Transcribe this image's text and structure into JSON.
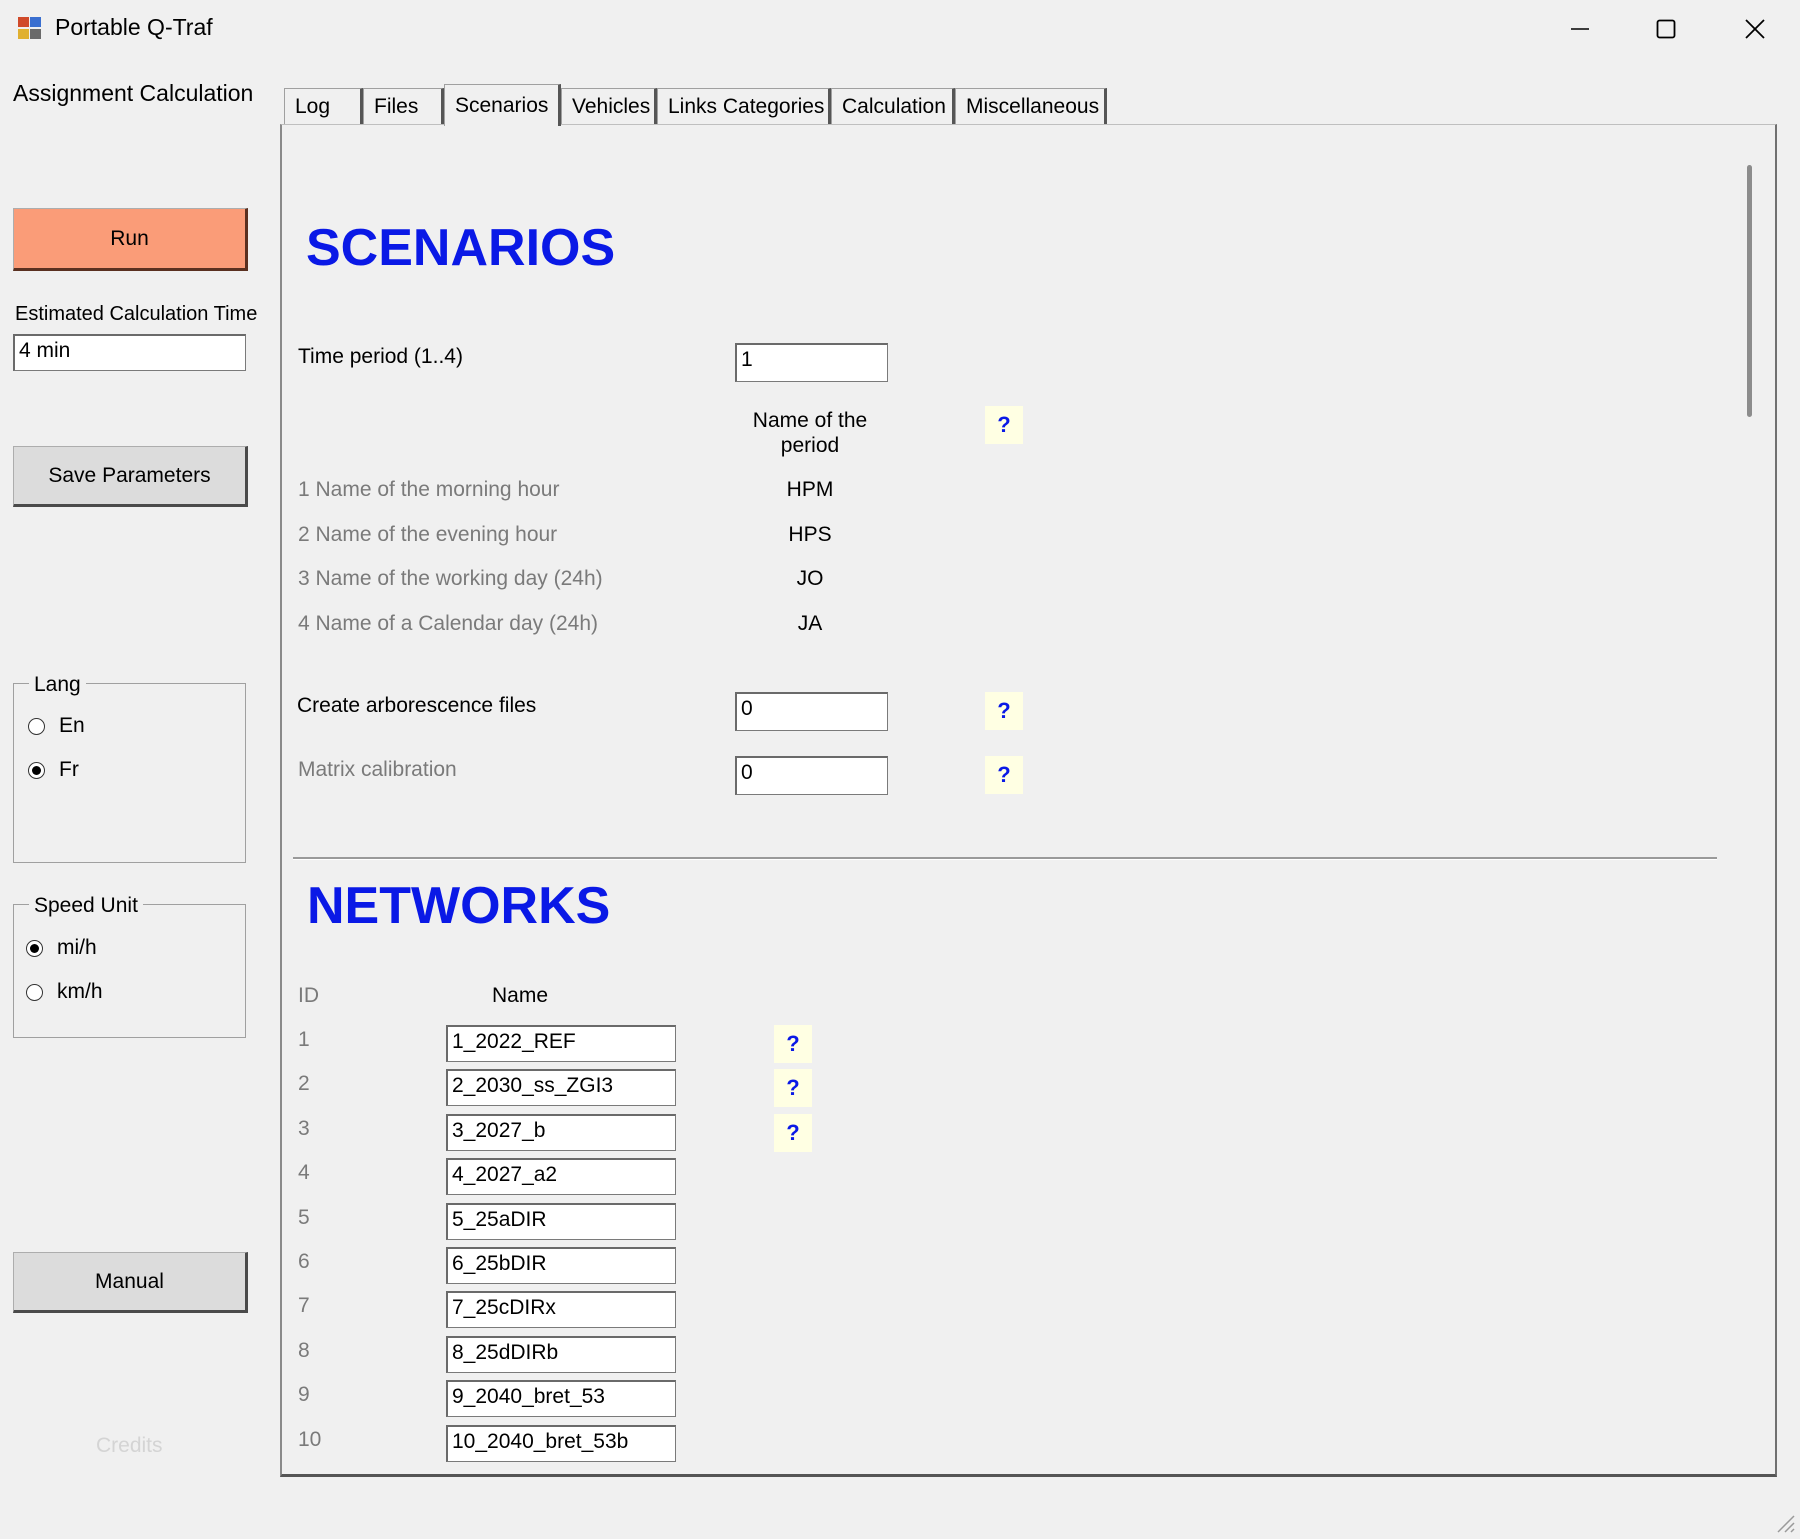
{
  "window": {
    "title": "Portable Q-Traf",
    "controls": [
      "minimize",
      "maximize",
      "close"
    ]
  },
  "sidebar": {
    "heading": "Assignment Calculation",
    "run_label": "Run",
    "estimated_time_label": "Estimated Calculation Time",
    "estimated_time_value": "4 min",
    "save_label": "Save Parameters",
    "lang_group": {
      "legend": "Lang",
      "options": [
        {
          "label": "En",
          "selected": false
        },
        {
          "label": "Fr",
          "selected": true
        }
      ]
    },
    "speed_group": {
      "legend": "Speed Unit",
      "options": [
        {
          "label": "mi/h",
          "selected": true
        },
        {
          "label": "km/h",
          "selected": false
        }
      ]
    },
    "manual_label": "Manual",
    "credits_label": "Credits"
  },
  "tabs": [
    {
      "label": "Log",
      "active": false
    },
    {
      "label": "Files",
      "active": false
    },
    {
      "label": "Scenarios",
      "active": true
    },
    {
      "label": "Vehicles",
      "active": false
    },
    {
      "label": "Links Categories",
      "active": false
    },
    {
      "label": "Calculation",
      "active": false
    },
    {
      "label": "Miscellaneous",
      "active": false
    }
  ],
  "scenarios": {
    "title": "SCENARIOS",
    "time_period_label": "Time period (1..4)",
    "time_period_value": "1",
    "period_name_header": "Name of the period",
    "periods": [
      {
        "label": "1 Name of the morning hour",
        "value": "HPM"
      },
      {
        "label": "2 Name of the evening hour",
        "value": "HPS"
      },
      {
        "label": "3 Name of the working day (24h)",
        "value": "JO"
      },
      {
        "label": "4 Name of a Calendar day (24h)",
        "value": "JA"
      }
    ],
    "arborescence_label": "Create arborescence files",
    "arborescence_value": "0",
    "matrix_label": "Matrix calibration",
    "matrix_value": "0",
    "help_symbol": "?"
  },
  "networks": {
    "title": "NETWORKS",
    "id_header": "ID",
    "name_header": "Name",
    "rows": [
      {
        "id": "1",
        "name": "1_2022_REF",
        "help": true
      },
      {
        "id": "2",
        "name": "2_2030_ss_ZGI3",
        "help": true
      },
      {
        "id": "3",
        "name": "3_2027_b",
        "help": true
      },
      {
        "id": "4",
        "name": "4_2027_a2",
        "help": false
      },
      {
        "id": "5",
        "name": "5_25aDIR",
        "help": false
      },
      {
        "id": "6",
        "name": "6_25bDIR",
        "help": false
      },
      {
        "id": "7",
        "name": "7_25cDIRx",
        "help": false
      },
      {
        "id": "8",
        "name": "8_25dDIRb",
        "help": false
      },
      {
        "id": "9",
        "name": "9_2040_bret_53",
        "help": false
      },
      {
        "id": "10",
        "name": "10_2040_bret_53b",
        "help": false
      }
    ]
  },
  "colors": {
    "run_button": "#fa9c78",
    "section_title": "#0a19e6",
    "help_background": "#ffffe3"
  }
}
